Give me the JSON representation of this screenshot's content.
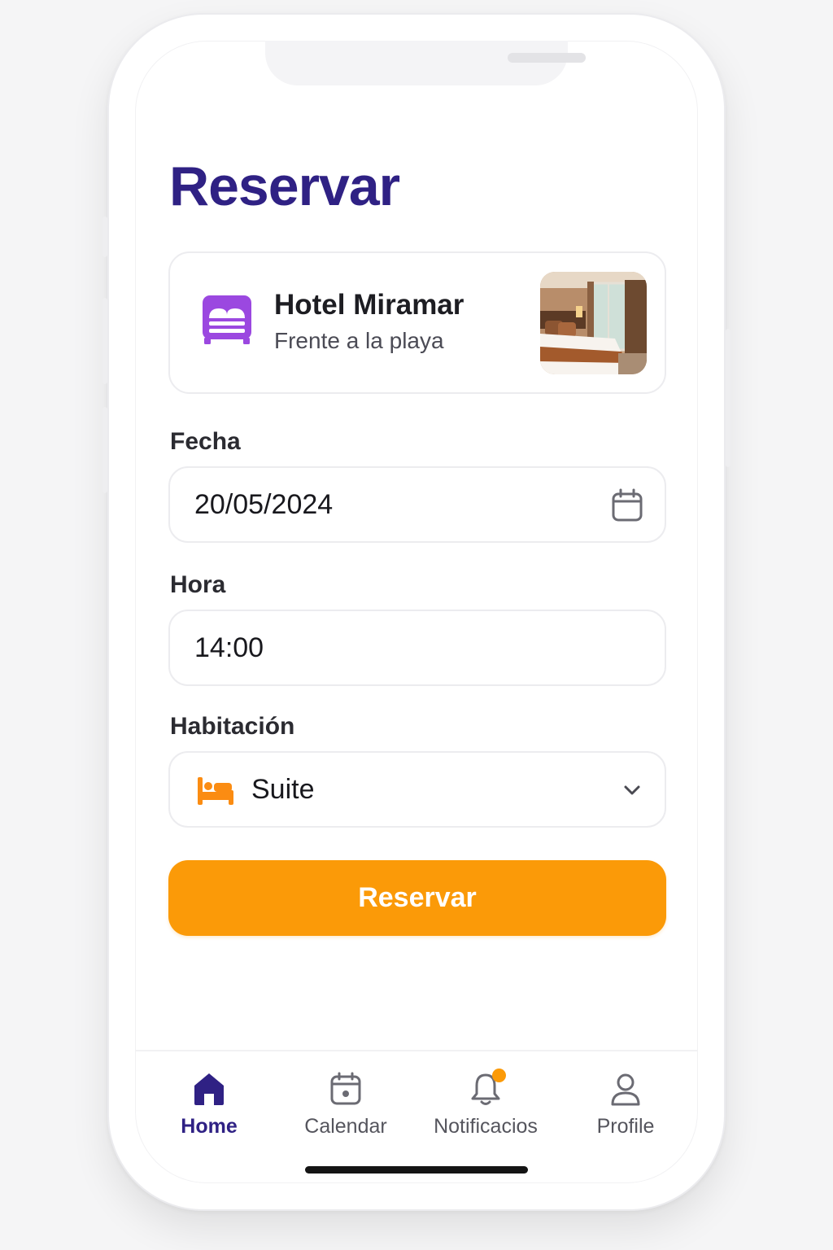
{
  "header": {
    "title": "Reservar"
  },
  "hotel": {
    "name": "Hotel Miramar",
    "subtitle": "Frente a la playa",
    "icon": "bed-icon",
    "photo": "hotel-room-photo"
  },
  "form": {
    "date": {
      "label": "Fecha",
      "value": "20/05/2024",
      "icon": "calendar-icon"
    },
    "time": {
      "label": "Hora",
      "value": "14:00"
    },
    "room": {
      "label": "Habitación",
      "value": "Suite",
      "icon": "bed-icon",
      "dropdown_icon": "chevron-down-icon"
    }
  },
  "submit": {
    "label": "Reservar"
  },
  "tabs": [
    {
      "label": "Home",
      "icon": "home-icon",
      "active": true
    },
    {
      "label": "Calendar",
      "icon": "calendar-icon",
      "active": false
    },
    {
      "label": "Notificacios",
      "icon": "bell-icon",
      "active": false,
      "badge": true
    },
    {
      "label": "Profile",
      "icon": "user-icon",
      "active": false
    }
  ],
  "colors": {
    "primary": "#2f2184",
    "accent": "#fb9a08",
    "hotel_icon": "#9b48e0",
    "border": "#ececef"
  }
}
